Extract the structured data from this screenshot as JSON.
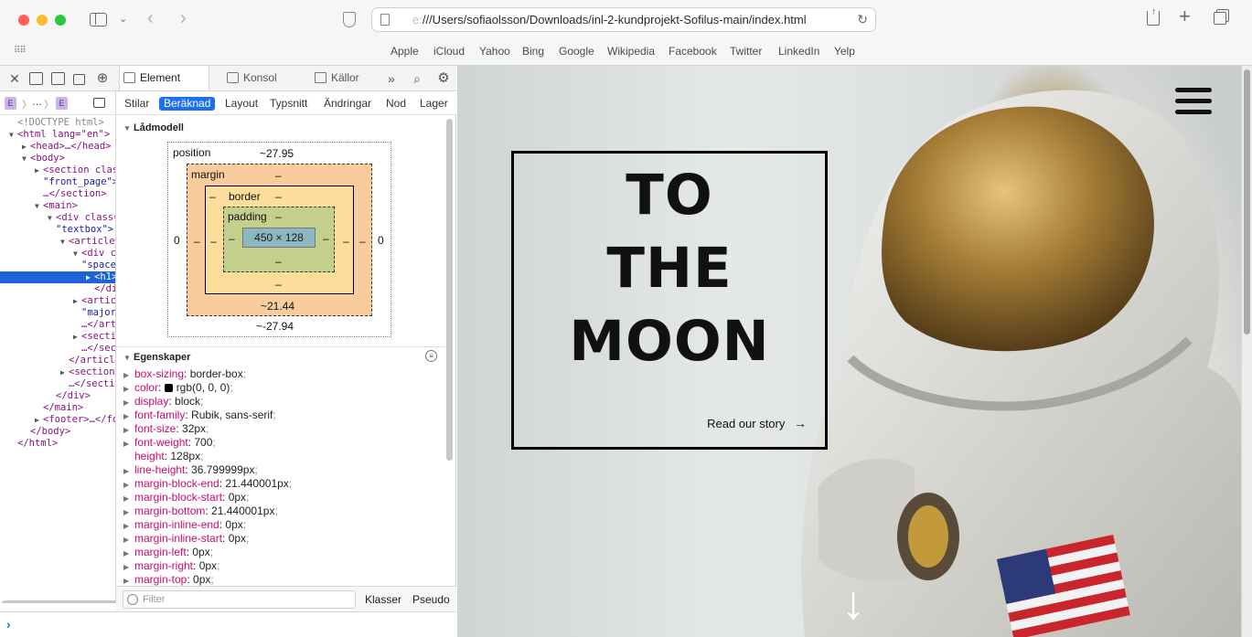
{
  "browser": {
    "url_scheme_hidden": "e:",
    "url_path": "///Users/sofiaolsson/Downloads/inl-2-kundprojekt-Sofilus-main/index.html",
    "bookmarks": [
      "Apple",
      "iCloud",
      "Yahoo",
      "Bing",
      "Google",
      "Wikipedia",
      "Facebook",
      "Twitter",
      "LinkedIn",
      "Yelp"
    ]
  },
  "devtools": {
    "tabs": [
      "Element",
      "Konsol",
      "Källor"
    ],
    "subtabs": [
      "Stilar",
      "Beräknad",
      "Layout",
      "Typsnitt",
      "Ändringar",
      "Nod",
      "Lager"
    ],
    "breadcrumb_ellipsis": "…",
    "dom": [
      {
        "indent": 0,
        "text": "<!DOCTYPE html>",
        "tri": "",
        "dim": true
      },
      {
        "indent": 0,
        "text": "<html lang=\"en\">",
        "tri": "▼"
      },
      {
        "indent": 1,
        "text": "<head>…</head>",
        "tri": "▶"
      },
      {
        "indent": 1,
        "text": "<body>",
        "tri": "▼"
      },
      {
        "indent": 2,
        "text": "<section class=",
        "tri": "▶"
      },
      {
        "indent": 2,
        "text": "\"front_page\">",
        "tri": "",
        "val": true
      },
      {
        "indent": 2,
        "text": "…</section>",
        "tri": ""
      },
      {
        "indent": 2,
        "text": "<main>",
        "tri": "▼"
      },
      {
        "indent": 3,
        "text": "<div class=",
        "tri": "▼"
      },
      {
        "indent": 3,
        "text": "\"textbox\">",
        "tri": "",
        "val": true
      },
      {
        "indent": 4,
        "text": "<article>",
        "tri": "▼"
      },
      {
        "indent": 5,
        "text": "<div class=",
        "tri": "▼"
      },
      {
        "indent": 5,
        "text": "\"space_",
        "tri": "",
        "val": true
      },
      {
        "indent": 6,
        "text": "<h1>",
        "tri": "▶",
        "sel": true
      },
      {
        "indent": 6,
        "text": "</div>",
        "tri": ""
      },
      {
        "indent": 5,
        "text": "<article class=",
        "tri": "▶"
      },
      {
        "indent": 5,
        "text": "\"major_",
        "tri": "",
        "val": true
      },
      {
        "indent": 5,
        "text": "…</article>",
        "tri": ""
      },
      {
        "indent": 5,
        "text": "<section>",
        "tri": "▶"
      },
      {
        "indent": 5,
        "text": "…</section>",
        "tri": ""
      },
      {
        "indent": 4,
        "text": "</article>",
        "tri": ""
      },
      {
        "indent": 4,
        "text": "<section>",
        "tri": "▶"
      },
      {
        "indent": 4,
        "text": "…</section>",
        "tri": ""
      },
      {
        "indent": 3,
        "text": "</div>",
        "tri": ""
      },
      {
        "indent": 2,
        "text": "</main>",
        "tri": ""
      },
      {
        "indent": 2,
        "text": "<footer>…</footer>",
        "tri": "▶"
      },
      {
        "indent": 1,
        "text": "</body>",
        "tri": ""
      },
      {
        "indent": 0,
        "text": "</html>",
        "tri": ""
      }
    ],
    "boxmodel": {
      "section_title": "Lådmodell",
      "position_label": "position",
      "position_top": "~27.95",
      "position_bottom": "~-27.94",
      "position_left": "0",
      "position_right": "0",
      "margin_label": "margin",
      "margin_top": "–",
      "margin_bottom": "~21.44",
      "margin_left": "–",
      "margin_right": "–",
      "border_label": "border",
      "border_top": "–",
      "border_bottom": "–",
      "border_left": "–",
      "border_right": "–",
      "padding_label": "padding",
      "padding_top": "–",
      "padding_bottom": "–",
      "padding_left": "–",
      "padding_right": "–",
      "content": "450 × 128"
    },
    "properties_title": "Egenskaper",
    "properties": [
      {
        "k": "box-sizing",
        "v": "border-box",
        "arrow": true
      },
      {
        "k": "color",
        "v": "rgb(0, 0, 0)",
        "arrow": true,
        "swatch": true
      },
      {
        "k": "display",
        "v": "block",
        "arrow": true
      },
      {
        "k": "font-family",
        "v": "Rubik, sans-serif",
        "arrow": true
      },
      {
        "k": "font-size",
        "v": "32px",
        "arrow": true
      },
      {
        "k": "font-weight",
        "v": "700",
        "arrow": true
      },
      {
        "k": "height",
        "v": "128px",
        "arrow": false
      },
      {
        "k": "line-height",
        "v": "36.799999px",
        "arrow": true
      },
      {
        "k": "margin-block-end",
        "v": "21.440001px",
        "arrow": true
      },
      {
        "k": "margin-block-start",
        "v": "0px",
        "arrow": true
      },
      {
        "k": "margin-bottom",
        "v": "21.440001px",
        "arrow": true
      },
      {
        "k": "margin-inline-end",
        "v": "0px",
        "arrow": true
      },
      {
        "k": "margin-inline-start",
        "v": "0px",
        "arrow": true
      },
      {
        "k": "margin-left",
        "v": "0px",
        "arrow": true
      },
      {
        "k": "margin-right",
        "v": "0px",
        "arrow": true
      },
      {
        "k": "margin-top",
        "v": "0px",
        "arrow": true
      }
    ],
    "filter_placeholder": "Filter",
    "classes_label": "Klasser",
    "pseudo_label": "Pseudo",
    "console_prompt": "›"
  },
  "page": {
    "heading": [
      "TO",
      "THE",
      "MOON"
    ],
    "story_link": "Read our story",
    "story_arrow": "→",
    "down_arrow": "↓"
  }
}
